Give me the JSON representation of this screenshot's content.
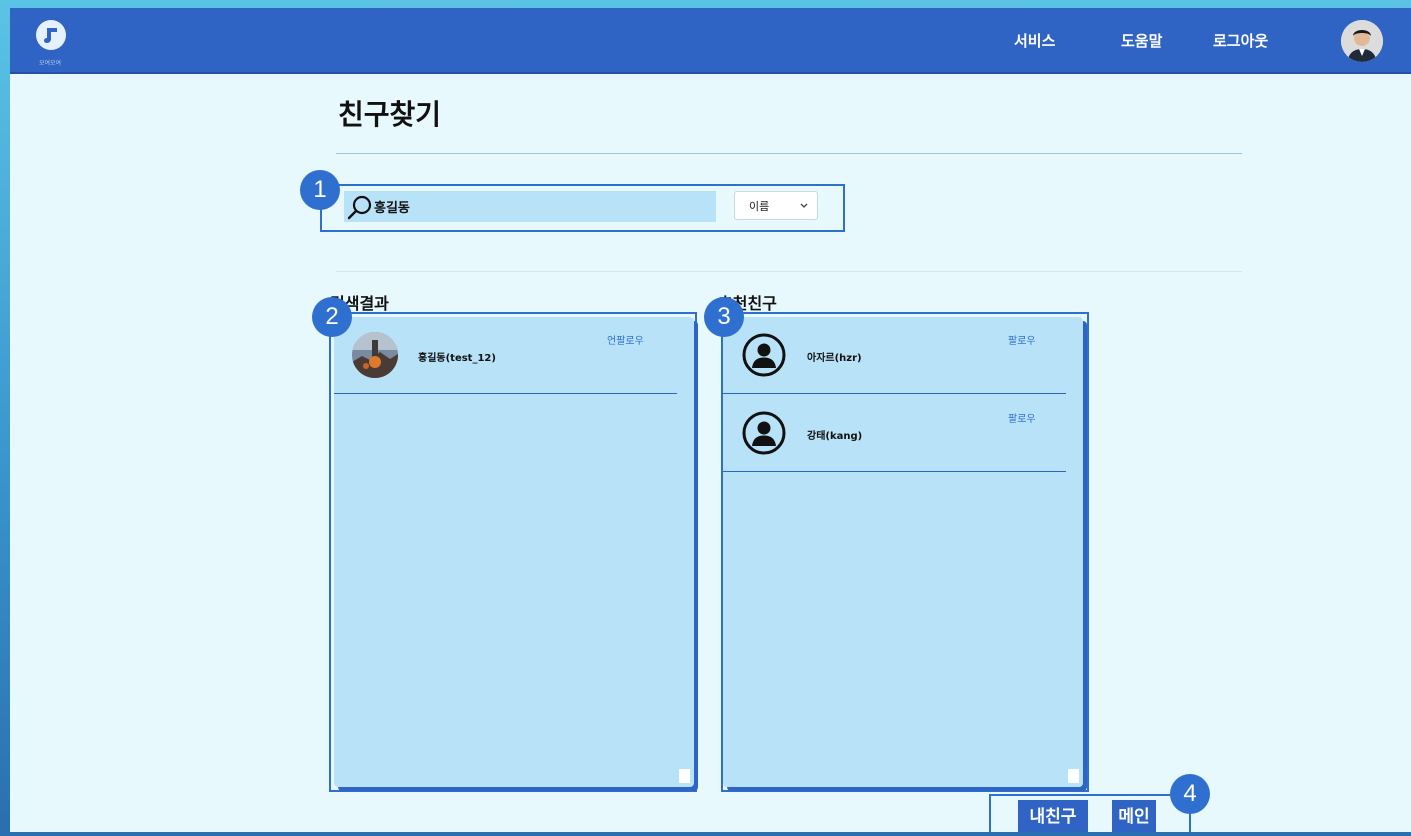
{
  "app": {
    "logo_text": "모여모여",
    "colors": {
      "primary": "#2f63c4",
      "accent": "#2f6fd0",
      "panel": "#b8e2f8",
      "background": "#e8f9fd"
    }
  },
  "nav": {
    "items": [
      {
        "label": "서비스"
      },
      {
        "label": "도움말"
      },
      {
        "label": "로그아웃"
      }
    ],
    "profile_icon": "user-avatar-icon"
  },
  "page": {
    "title": "친구찾기"
  },
  "search": {
    "value": "홍길동",
    "icon": "search-icon",
    "select_value": "이름",
    "select_icon": "chevron-down-icon"
  },
  "results": {
    "title": "검색결과",
    "items": [
      {
        "name": "홍길동(test_12)",
        "action": "언팔로우"
      }
    ]
  },
  "recommended": {
    "title": "추천친구",
    "items": [
      {
        "name": "아자르(hzr)",
        "action": "팔로우"
      },
      {
        "name": "강태(kang)",
        "action": "팔로우"
      }
    ]
  },
  "buttons": {
    "my_friends": "내친구",
    "main": "메인"
  },
  "callouts": [
    "1",
    "2",
    "3",
    "4"
  ]
}
